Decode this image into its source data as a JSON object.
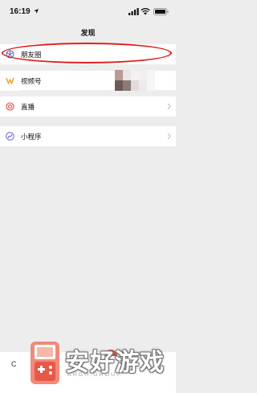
{
  "status_bar": {
    "time": "16:19"
  },
  "header": {
    "title": "发现"
  },
  "menu": [
    {
      "label": "朋友圈",
      "icon": "moments-icon"
    },
    {
      "label": "视频号",
      "icon": "channels-icon"
    },
    {
      "label": "直播",
      "icon": "live-icon"
    },
    {
      "label": "小程序",
      "icon": "mini-program-icon"
    }
  ],
  "bottom": {
    "partial_text": "C"
  },
  "watermark": {
    "brand": "安好游戏",
    "domain": "AHGH.GROUP"
  },
  "colors": {
    "background": "#ededed",
    "annotation": "#e02020",
    "moments_icon": "#4a5aa8",
    "channels_icon": "#f0a020",
    "live_icon": "#e0493a",
    "mini_program_icon": "#6a6ad8"
  }
}
